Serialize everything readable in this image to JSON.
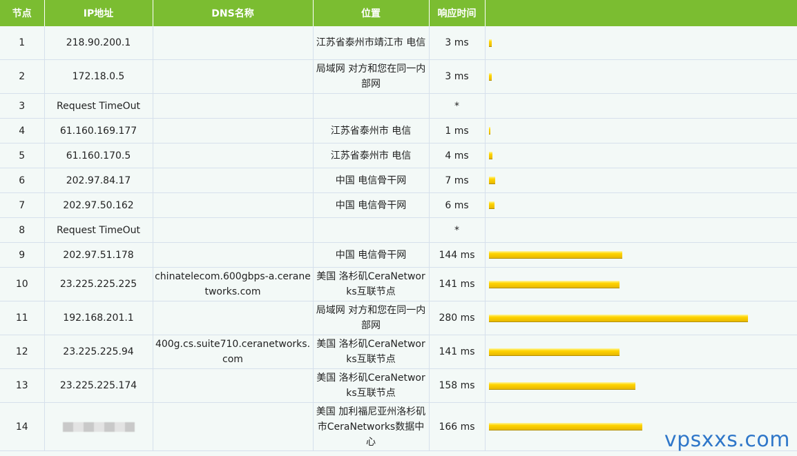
{
  "headers": {
    "hop": "节点",
    "ip": "IP地址",
    "dns": "DNS名称",
    "location": "位置",
    "time": "响应时间",
    "bar": ""
  },
  "rows": [
    {
      "hop": "1",
      "ip": "218.90.200.1",
      "dns": "",
      "location": "江苏省泰州市靖江市 电信",
      "time": "3 ms",
      "ms": 3
    },
    {
      "hop": "2",
      "ip": "172.18.0.5",
      "dns": "",
      "location": "局域网 对方和您在同一内部网",
      "time": "3 ms",
      "ms": 3
    },
    {
      "hop": "3",
      "ip": "Request TimeOut",
      "dns": "",
      "location": "",
      "time": "*",
      "ms": 0
    },
    {
      "hop": "4",
      "ip": "61.160.169.177",
      "dns": "",
      "location": "江苏省泰州市 电信",
      "time": "1 ms",
      "ms": 1
    },
    {
      "hop": "5",
      "ip": "61.160.170.5",
      "dns": "",
      "location": "江苏省泰州市 电信",
      "time": "4 ms",
      "ms": 4
    },
    {
      "hop": "6",
      "ip": "202.97.84.17",
      "dns": "",
      "location": "中国 电信骨干网",
      "time": "7 ms",
      "ms": 7
    },
    {
      "hop": "7",
      "ip": "202.97.50.162",
      "dns": "",
      "location": "中国 电信骨干网",
      "time": "6 ms",
      "ms": 6
    },
    {
      "hop": "8",
      "ip": "Request TimeOut",
      "dns": "",
      "location": "",
      "time": "*",
      "ms": 0
    },
    {
      "hop": "9",
      "ip": "202.97.51.178",
      "dns": "",
      "location": "中国 电信骨干网",
      "time": "144 ms",
      "ms": 144
    },
    {
      "hop": "10",
      "ip": "23.225.225.225",
      "dns": "chinatelecom.600gbps-a.ceranetworks.com",
      "location": "美国 洛杉矶CeraNetworks互联节点",
      "time": "141 ms",
      "ms": 141
    },
    {
      "hop": "11",
      "ip": "192.168.201.1",
      "dns": "",
      "location": "局域网 对方和您在同一内部网",
      "time": "280 ms",
      "ms": 280
    },
    {
      "hop": "12",
      "ip": "23.225.225.94",
      "dns": "400g.cs.suite710.ceranetworks.com",
      "location": "美国 洛杉矶CeraNetworks互联节点",
      "time": "141 ms",
      "ms": 141
    },
    {
      "hop": "13",
      "ip": "23.225.225.174",
      "dns": "",
      "location": "美国 洛杉矶CeraNetworks互联节点",
      "time": "158 ms",
      "ms": 158
    },
    {
      "hop": "14",
      "ip": "",
      "dns": "",
      "location": "美国 加利福尼亚州洛杉矶市CeraNetworks数据中心",
      "time": "166 ms",
      "ms": 166
    }
  ],
  "watermark": "vpsxxs.com",
  "colors": {
    "header_bg": "#7bbd31",
    "bar": "#ffd400",
    "watermark": "#2f77c9"
  }
}
